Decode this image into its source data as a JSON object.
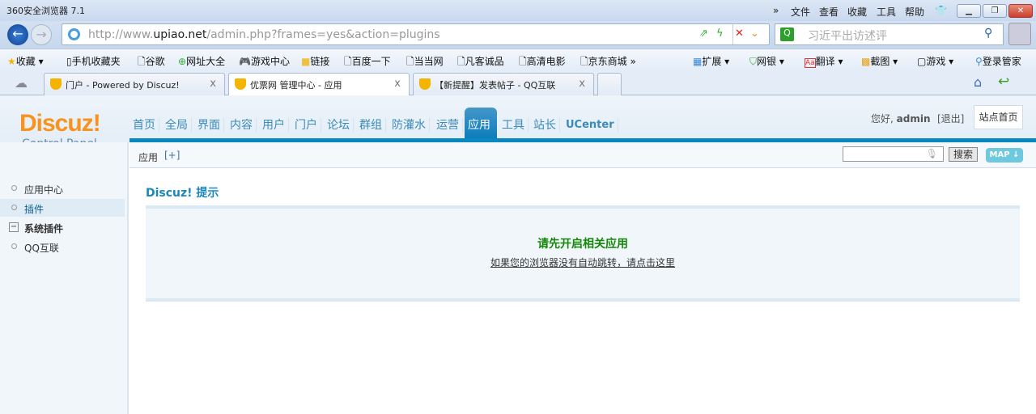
{
  "browser": {
    "title": "360安全浏览器 7.1",
    "menu": [
      "»",
      "文件",
      "查看",
      "收藏",
      "工具",
      "帮助"
    ],
    "url_host": "http://www.upiao.net",
    "url_path": "/admin.php?frames=yes&action=plugins",
    "url_prefix": "http://www.",
    "url_domain": "upiao.net",
    "search_placeholder": "习近平出访述评",
    "bookmarks": [
      "收藏",
      "手机收藏夹",
      "谷歌",
      "网址大全",
      "游戏中心",
      "链接",
      "百度一下",
      "当当网",
      "凡客诚品",
      "高清电影",
      "京东商城"
    ],
    "tools": [
      "扩展",
      "网银",
      "翻译",
      "截图",
      "游戏",
      "登录管家"
    ],
    "tabs": [
      "门户 - Powered by Discuz!",
      "优票网 管理中心 - 应用",
      "【新提醒】发表帖子 - QQ互联"
    ]
  },
  "admin": {
    "logo": "Discuz!",
    "logo_sub": "Control Panel",
    "nav": [
      "首页",
      "全局",
      "界面",
      "内容",
      "用户",
      "门户",
      "论坛",
      "群组",
      "防灌水",
      "运营",
      "应用",
      "工具",
      "站长",
      "UCenter"
    ],
    "greeting": "您好,",
    "user": "admin",
    "logout": "[退出]",
    "home": "站点首页",
    "subnav": "应用",
    "subnav_add": "[+]",
    "search_btn": "搜索",
    "map": "MAP",
    "sidebar": [
      "应用中心",
      "插件",
      "系统插件",
      "QQ互联"
    ],
    "content_title": "Discuz! 提示",
    "message": "请先开启相关应用",
    "redirect": "如果您的浏览器没有自动跳转，请点击这里"
  },
  "colors": {
    "accent": "#0987c1",
    "logo": "#f7931e",
    "message": "#14870b"
  }
}
